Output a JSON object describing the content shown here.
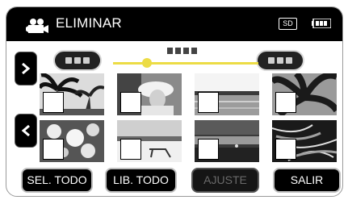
{
  "header": {
    "title": "ELIMINAR",
    "media_badge": "SD",
    "mode_icon": "video-camera-icon",
    "battery_icon": "battery-icon"
  },
  "navigation": {
    "next_icon": "chevron-right-icon",
    "prev_icon": "chevron-left-icon"
  },
  "slider": {
    "position_fraction": 0.25,
    "accent_color": "#ecdc45"
  },
  "thumbnails": [
    {
      "scene": "palm-trees",
      "checked": false
    },
    {
      "scene": "person-with-hat",
      "checked": false
    },
    {
      "scene": "sea-horizon",
      "checked": false
    },
    {
      "scene": "palm-leaves",
      "checked": false
    },
    {
      "scene": "flowers",
      "checked": false
    },
    {
      "scene": "beach-chairs",
      "checked": false
    },
    {
      "scene": "sunset-beach",
      "checked": false
    },
    {
      "scene": "dark-foliage",
      "checked": false
    }
  ],
  "buttons": {
    "select_all": "SEL. TODO",
    "release_all": "LIB. TODO",
    "adjust": "AJUSTE",
    "exit": "SALIR"
  }
}
